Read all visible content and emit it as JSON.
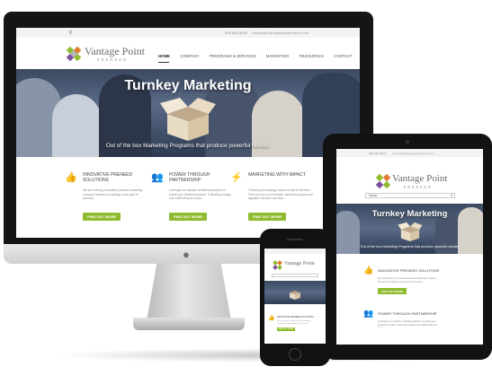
{
  "brand": {
    "name": "Vantage Point",
    "tagline": "PRENEED",
    "colors": {
      "green": "#8fbc2f",
      "purple": "#7b4f9e",
      "orange": "#e07a2a",
      "dark_bezel": "#151515"
    }
  },
  "topbar": {
    "phone": "888-888-8888",
    "email": "contact@vantagepointpreneed.com",
    "search_icon": "search-icon"
  },
  "nav": {
    "items": [
      "HOME",
      "COMPANY",
      "PROGRAMS & SERVICES",
      "MARKETING",
      "RESOURCES",
      "CONTACT"
    ],
    "active": "HOME",
    "mobile_select": "Home"
  },
  "hero": {
    "title": "Turnkey Marketing",
    "subtitle": "Out of the box Marketing Programs that produce powerful results."
  },
  "features": [
    {
      "icon": "thumbs-up-icon",
      "title": "INNOVATIVE PRENEED SOLUTIONS",
      "text": "We are a strong, innovative preneed marketing company focused on building a true point of success...",
      "button": "FIND OUT MORE"
    },
    {
      "icon": "people-icon",
      "title": "POWER THROUGH PARTNERSHIP",
      "text": "Leverage our network of talented partners to propel your business forward. Cultivating change one relationship at a time...",
      "button": "FIND OUT MORE"
    },
    {
      "icon": "lightning-icon",
      "title": "MARKETING WITH IMPACT",
      "text": "Following our strategy means money in the bank. Find out how our innovative marketing support and signature services can help...",
      "button": "FIND OUT MORE"
    }
  ]
}
